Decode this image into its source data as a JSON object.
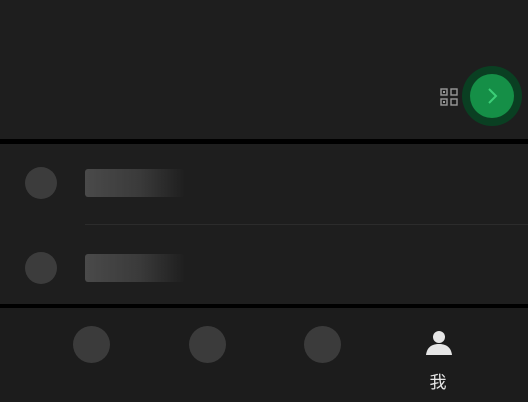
{
  "header": {
    "qr_icon": "qr-code-icon",
    "go_icon": "chevron-right-icon",
    "accent_color": "#158f47"
  },
  "list": {
    "items": [
      {
        "icon": "avatar-placeholder"
      },
      {
        "icon": "avatar-placeholder"
      }
    ]
  },
  "tabbar": {
    "tabs": [
      {
        "label": "",
        "icon": "placeholder-circle"
      },
      {
        "label": "",
        "icon": "placeholder-circle"
      },
      {
        "label": "",
        "icon": "placeholder-circle"
      },
      {
        "label": "我",
        "icon": "person-icon"
      }
    ]
  }
}
